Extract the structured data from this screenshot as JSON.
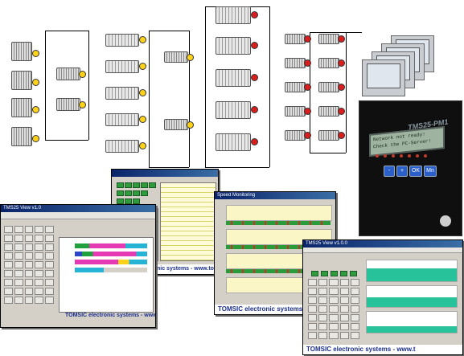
{
  "device": {
    "title": "TMS25-PM1",
    "lcd_line1": "Network not ready!",
    "lcd_line2": "Check the PC-Server!",
    "buttons": [
      "-",
      "+",
      "OK",
      "Mn"
    ]
  },
  "windows": {
    "main": {
      "title": "TMS25 View v1.0",
      "footer": "TOMSIC electronic systems - www.tomsic.fi"
    },
    "table": {
      "footer": "TOMSIC electronic systems - www.tomsic.fi"
    },
    "trend": {
      "title": "Speed Monitoring",
      "footer": "TOMSIC electronic systems - www.t"
    },
    "view": {
      "title": "TMS25 View v1.0.0",
      "footer": "TOMSIC electronic systems - www.t"
    }
  }
}
